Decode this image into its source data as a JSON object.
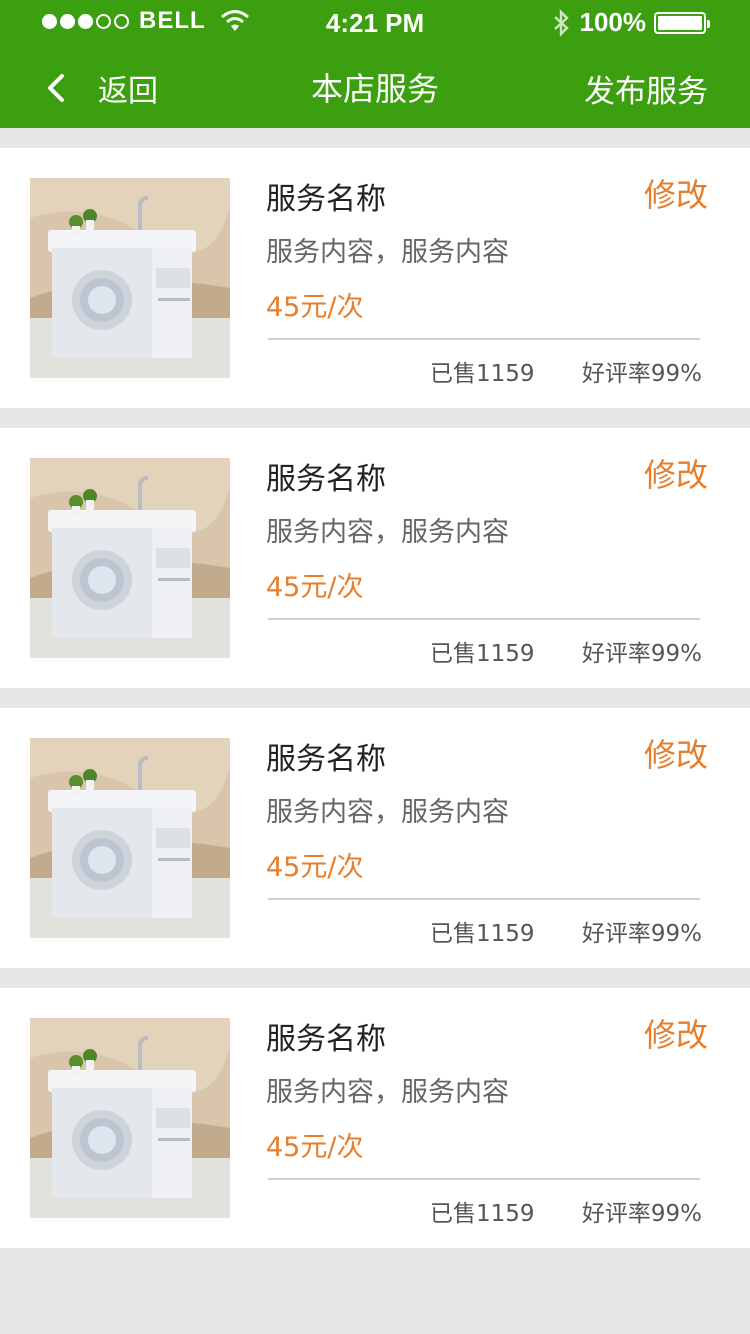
{
  "status_bar": {
    "carrier": "BELL",
    "time": "4:21 PM",
    "battery": "100%"
  },
  "nav": {
    "back_label": "返回",
    "title": "本店服务",
    "publish_label": "发布服务"
  },
  "services": [
    {
      "name": "服务名称",
      "edit": "修改",
      "desc": "服务内容，服务内容",
      "price": "45元/次",
      "sold": "已售1159",
      "rate": "好评率99%"
    },
    {
      "name": "服务名称",
      "edit": "修改",
      "desc": "服务内容，服务内容",
      "price": "45元/次",
      "sold": "已售1159",
      "rate": "好评率99%"
    },
    {
      "name": "服务名称",
      "edit": "修改",
      "desc": "服务内容，服务内容",
      "price": "45元/次",
      "sold": "已售1159",
      "rate": "好评率99%"
    },
    {
      "name": "服务名称",
      "edit": "修改",
      "desc": "服务内容，服务内容",
      "price": "45元/次",
      "sold": "已售1159",
      "rate": "好评率99%"
    }
  ],
  "colors": {
    "header_green": "#3c9f10",
    "accent_orange": "#e87e2a",
    "background_gray": "#e7e7e7"
  }
}
